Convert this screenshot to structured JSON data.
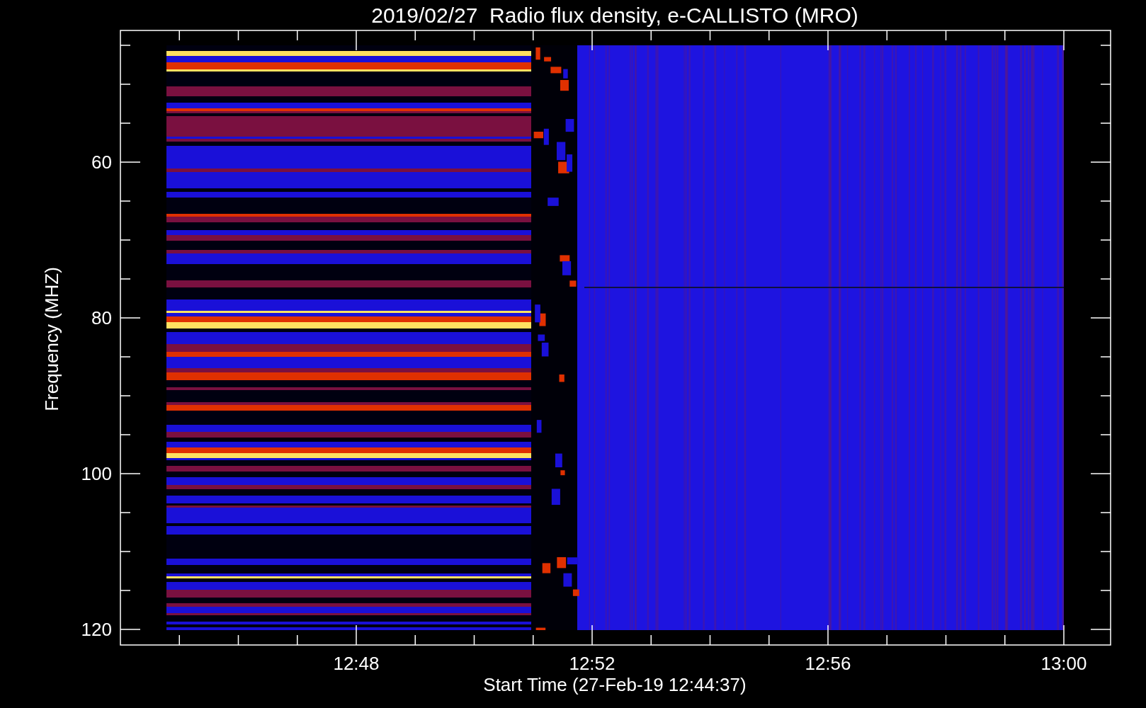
{
  "title": "2019/02/27  Radio flux density, e-CALLISTO (MRO)",
  "y_axis": {
    "label": "Frequency (MHZ)",
    "ticks": [
      "60",
      "80",
      "100",
      "120"
    ]
  },
  "x_axis": {
    "label": "Start Time (27-Feb-19 12:44:37)",
    "ticks": [
      "12:48",
      "12:52",
      "12:56",
      "13:00"
    ]
  }
}
